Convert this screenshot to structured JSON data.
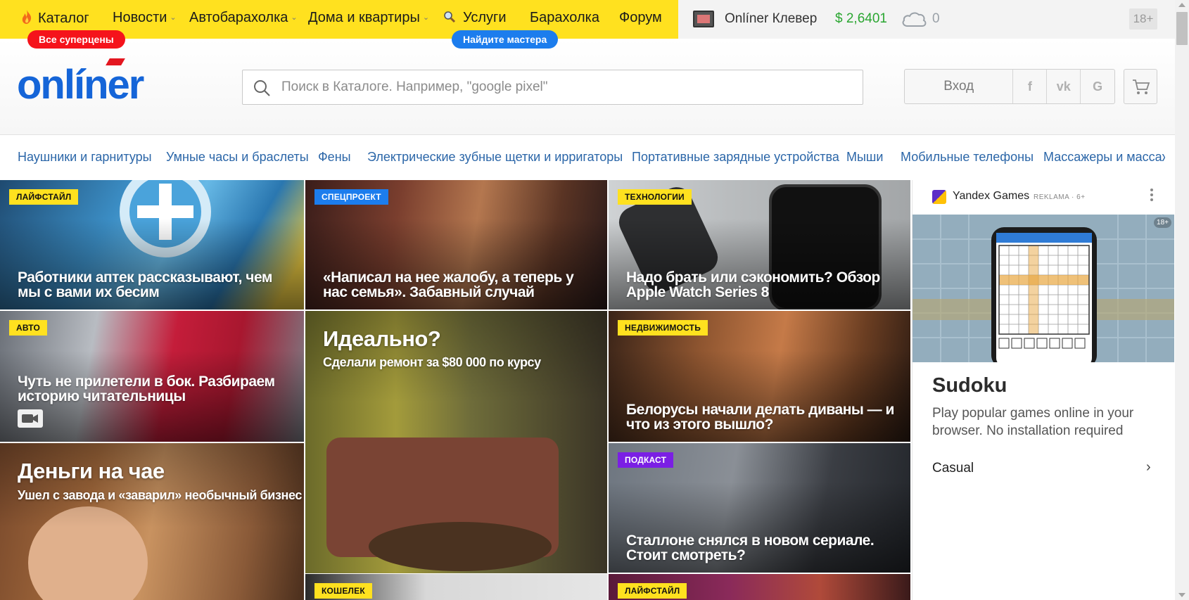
{
  "topbar": {
    "nav": [
      {
        "label": "Каталог",
        "icon": "fire-icon"
      },
      {
        "label": "Новости",
        "dropdown": true
      },
      {
        "label": "Автобарахолка",
        "dropdown": true
      },
      {
        "label": "Дома и квартиры",
        "dropdown": true
      },
      {
        "label": "Услуги",
        "icon": "search-icon"
      },
      {
        "label": "Барахолка"
      },
      {
        "label": "Форум"
      }
    ],
    "promo_red": "Все суперцены",
    "promo_blue": "Найдите мастера",
    "clever": "Onlíner Клевер",
    "currency": "$ 2,6401",
    "weather": "0",
    "age": "18+",
    "colors": {
      "yellow": "#ffe11f",
      "red": "#f5131b",
      "blue": "#1c7ded",
      "green": "#2aa631"
    }
  },
  "header": {
    "logo": "onlíner",
    "search_placeholder": "Поиск в Каталоге. Например, \"google pixel\"",
    "login": "Вход",
    "social": [
      "f",
      "vk",
      "G"
    ]
  },
  "categories": [
    "Наушники и гарнитуры",
    "Умные часы и браслеты",
    "Фены",
    "Электрические зубные щетки и ирригаторы",
    "Портативные зарядные устройства",
    "Мыши",
    "Мобильные телефоны",
    "Массажеры и массаже"
  ],
  "tiles": {
    "t1": {
      "tag": "Лайфстайл",
      "title": "Работники аптек рассказывают, чем мы с вами их бесим"
    },
    "t2": {
      "tag": "Спецпроект",
      "title": "«Написал на нее жалобу, а теперь у нас семья». Забавный случай"
    },
    "t3": {
      "tag": "Технологии",
      "title": "Надо брать или сэкономить? Обзор Apple Watch Series 8"
    },
    "t4": {
      "tag": "Авто",
      "title": "Чуть не прилетели в бок. Разбираем историю читательницы"
    },
    "t5": {
      "title": "Идеально?",
      "subtitle": "Сделали ремонт за $80 000 по курсу"
    },
    "t6": {
      "tag": "Недвижимость",
      "title": "Белорусы начали делать диваны — и что из этого вышло?"
    },
    "t7": {
      "title": "Деньги на чае",
      "subtitle": "Ушел с завода и «заварил» необычный бизнес"
    },
    "t8": {
      "tag": "Подкаст",
      "title": "Сталлоне снялся в новом сериале. Стоит смотреть?"
    },
    "t9": {
      "tag": "Кошелек"
    },
    "t10": {
      "tag": "Лайфстайл"
    }
  },
  "ad": {
    "brand": "Yandex Games",
    "label": "REKLAMA · 6+",
    "age": "18+",
    "title": "Sudoku",
    "description": "Play popular games online in your browser. No installation required",
    "category": "Casual"
  }
}
